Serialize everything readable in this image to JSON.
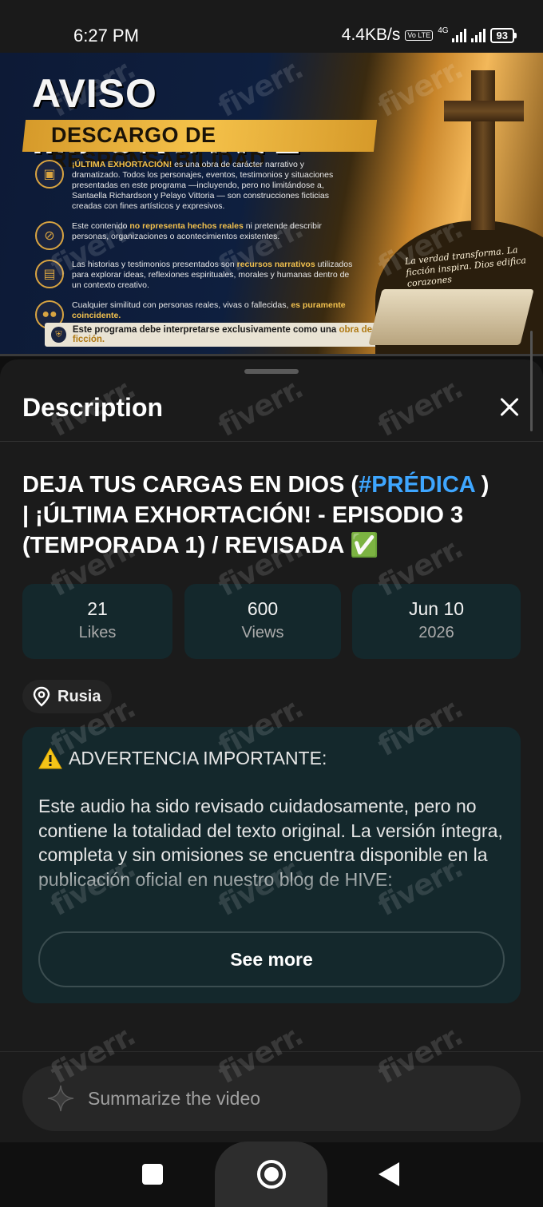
{
  "status_bar": {
    "time": "6:27 PM",
    "net_speed": "4.4KB/s",
    "volte": "Vo LTE",
    "network": "4G",
    "battery": "93"
  },
  "thumbnail": {
    "title": "AVISO IMPORTANTE",
    "subtitle": "DESCARGO DE RESPONSABILIDAD",
    "item1_lead": "¡ÚLTIMA EXHORTACIÓN!",
    "item1_rest": " es una obra de carácter narrativo y dramatizado. Todos los personajes, eventos, testimonios y situaciones presentadas en este programa —incluyendo, pero no limitándose a, Santaella Richardson y Pelayo Vittoria — son construcciones ficticias creadas con fines artísticos y expresivos.",
    "item2_a": "Este contenido ",
    "item2_b": "no representa hechos reales",
    "item2_c": " ni pretende describir personas, organizaciones o acontecimientos existentes.",
    "item3_a": "Las historias y testimonios presentados son ",
    "item3_b": "recursos narrativos",
    "item3_c": " utilizados para explorar ideas, reflexiones espirituales, morales y humanas dentro de un contexto creativo.",
    "item4_a": "Cualquier similitud con personas reales, vivas o fallecidas, ",
    "item4_b": "es puramente coincidente.",
    "footer_a": "Este programa debe interpretarse exclusivamente como una ",
    "footer_b": "obra de ficción.",
    "quote": "La verdad transforma. La ficción inspira. Dios edifica corazones"
  },
  "sheet": {
    "title": "Description",
    "video_title_a": "DEJA TUS CARGAS EN DIOS (",
    "video_title_tag": "#PRÉDICA",
    "video_title_b": " ) | ¡ÚLTIMA EXHORTACIÓN! - EPISODIO 3 (TEMPORADA 1) / REVISADA ✅",
    "stats": {
      "likes_value": "21",
      "likes_label": "Likes",
      "views_value": "600",
      "views_label": "Views",
      "date_value": "Jun 10",
      "date_year": "2026"
    },
    "location": "Rusia",
    "description": {
      "warning": "ADVERTENCIA IMPORTANTE:",
      "body": "Este audio ha sido revisado cuidadosamente, pero no contiene la totalidad del texto original. La versión íntegra, completa y sin omisiones se encuentra disponible en la publicación oficial en nuestro blog de HIVE:",
      "see_more": "See more"
    },
    "ask_placeholder": "Summarize the video"
  },
  "watermark": "fiverr.",
  "colors": {
    "sheet_bg": "#1b1b1b",
    "card_bg": "#14282c",
    "hashtag": "#3ea6ff",
    "gold": "#f2c14e"
  },
  "icons": [
    "signal-icon",
    "battery-icon",
    "close-icon",
    "location-pin-icon",
    "warning-icon",
    "sparkle-icon",
    "recents-icon",
    "home-icon",
    "back-icon"
  ]
}
